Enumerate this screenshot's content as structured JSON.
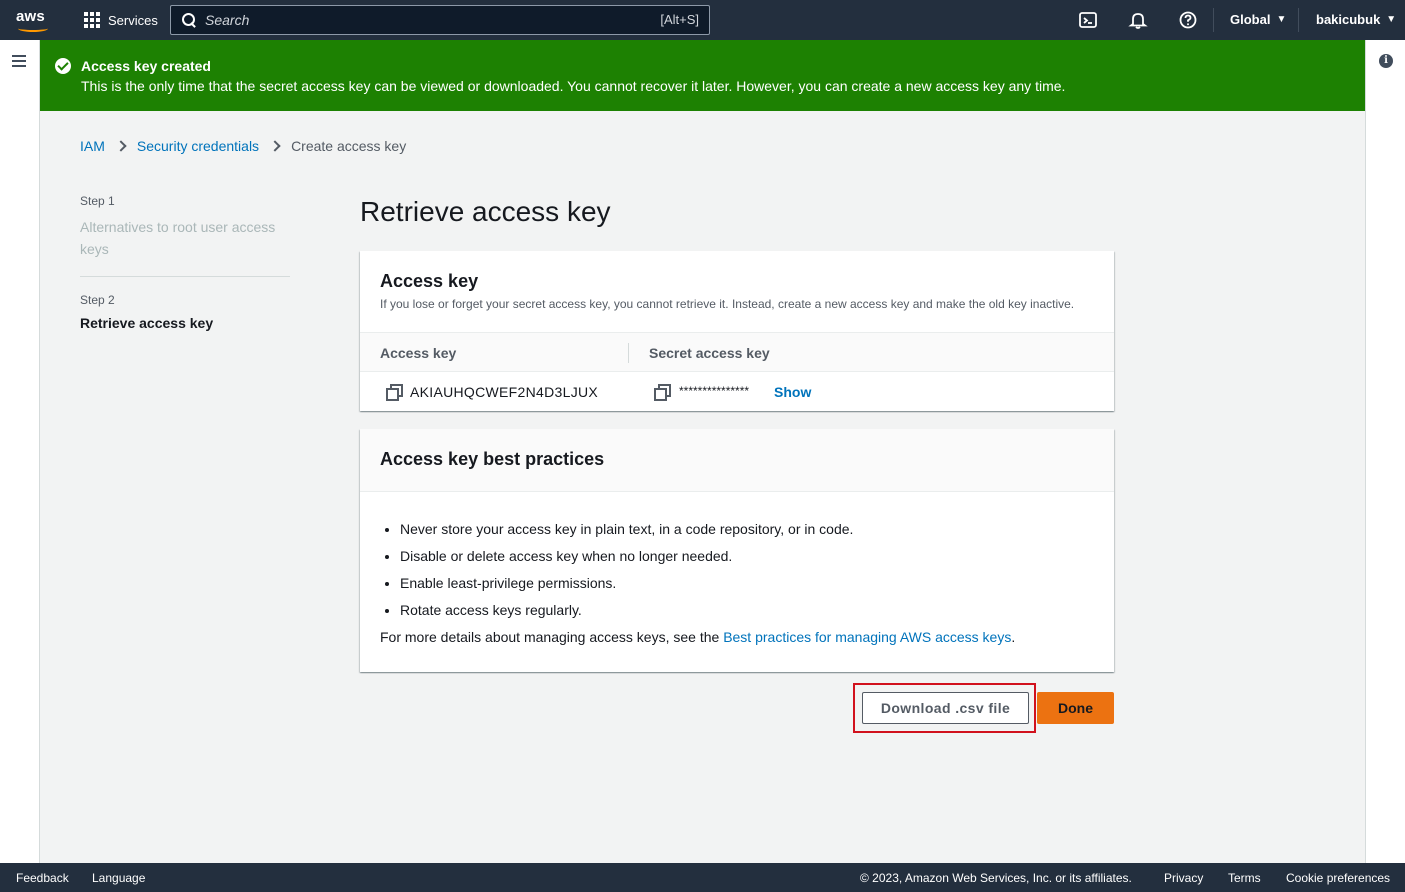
{
  "topnav": {
    "logo_text": "aws",
    "services_label": "Services",
    "search_placeholder": "Search",
    "search_shortcut": "[Alt+S]",
    "region_label": "Global",
    "user_label": "bakicubuk"
  },
  "flash": {
    "title": "Access key created",
    "message": "This is the only time that the secret access key can be viewed or downloaded. You cannot recover it later. However, you can create a new access key any time."
  },
  "breadcrumb": {
    "items": [
      "IAM",
      "Security credentials"
    ],
    "current": "Create access key"
  },
  "steps": [
    {
      "number": "Step 1",
      "label": "Alternatives to root user access keys"
    },
    {
      "number": "Step 2",
      "label": "Retrieve access key"
    }
  ],
  "page_title": "Retrieve access key",
  "access_key_card": {
    "title": "Access key",
    "description": "If you lose or forget your secret access key, you cannot retrieve it. Instead, create a new access key and make the old key inactive.",
    "columns": [
      "Access key",
      "Secret access key"
    ],
    "access_key_value": "AKIAUHQCWEF2N4D3LJUX",
    "secret_masked": "***************",
    "show_label": "Show"
  },
  "best_practices_card": {
    "title": "Access key best practices",
    "items": [
      "Never store your access key in plain text, in a code repository, or in code.",
      "Disable or delete access key when no longer needed.",
      "Enable least-privilege permissions.",
      "Rotate access keys regularly."
    ],
    "footer_prefix": "For more details about managing access keys, see the ",
    "footer_link": "Best practices for managing AWS access keys",
    "footer_suffix": "."
  },
  "actions": {
    "download_label": "Download .csv file",
    "done_label": "Done"
  },
  "footer": {
    "feedback": "Feedback",
    "language": "Language",
    "copyright": "© 2023, Amazon Web Services, Inc. or its affiliates.",
    "privacy": "Privacy",
    "terms": "Terms",
    "cookies": "Cookie preferences"
  },
  "colors": {
    "nav_bg": "#232f3e",
    "success_green": "#1d8102",
    "link_blue": "#0073bb",
    "primary_orange": "#ec7211",
    "highlight_red": "#d1111d"
  }
}
